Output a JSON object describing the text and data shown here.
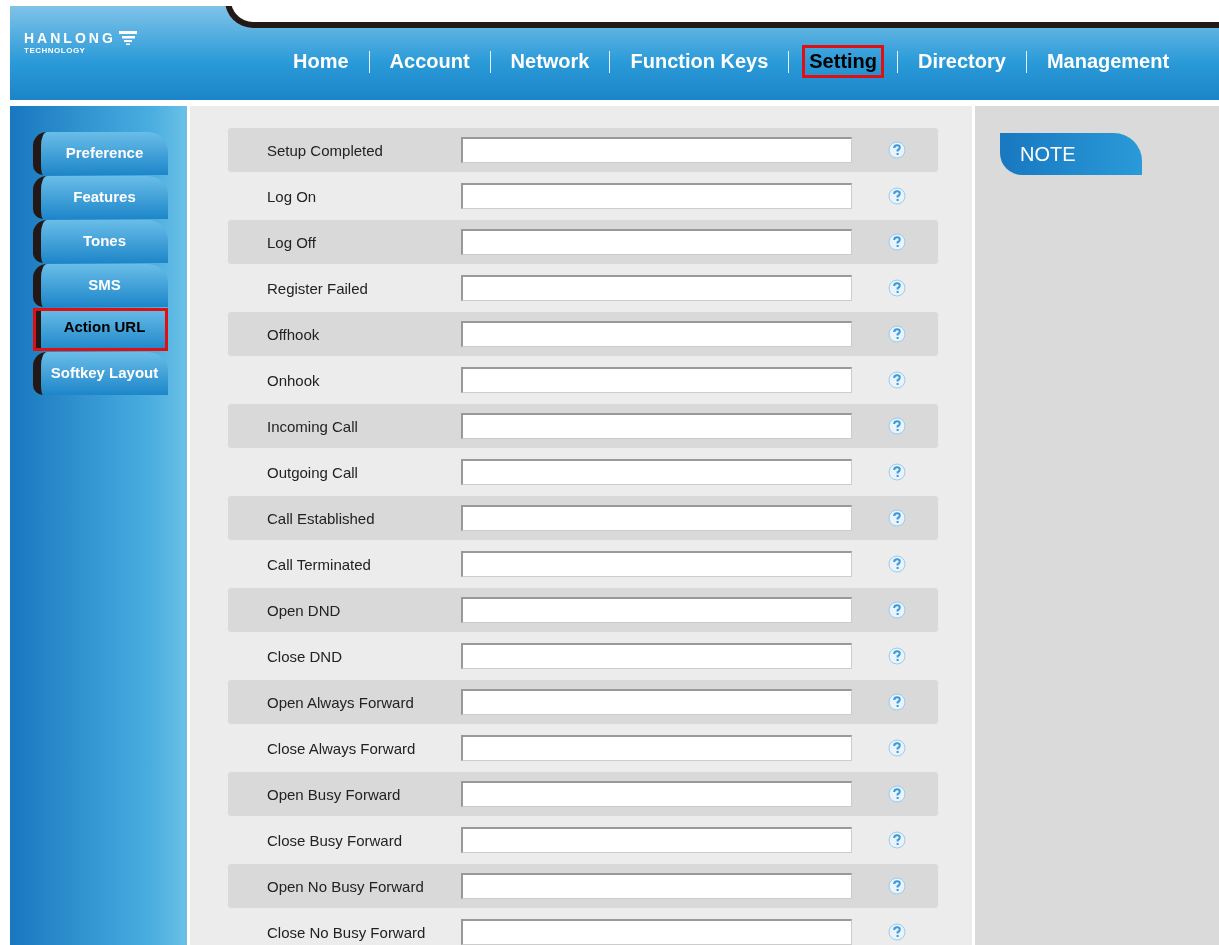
{
  "logo": {
    "name": "HANLONG",
    "tagline": "TECHNOLOGY"
  },
  "nav": [
    {
      "label": "Home",
      "selected": false
    },
    {
      "label": "Account",
      "selected": false
    },
    {
      "label": "Network",
      "selected": false
    },
    {
      "label": "Function Keys",
      "selected": false
    },
    {
      "label": "Setting",
      "selected": true
    },
    {
      "label": "Directory",
      "selected": false
    },
    {
      "label": "Management",
      "selected": false
    }
  ],
  "sidebar": [
    {
      "label": "Preference",
      "selected": false
    },
    {
      "label": "Features",
      "selected": false
    },
    {
      "label": "Tones",
      "selected": false
    },
    {
      "label": "SMS",
      "selected": false
    },
    {
      "label": "Action URL",
      "selected": true
    },
    {
      "label": "Softkey Layout",
      "selected": false
    }
  ],
  "fields": [
    {
      "label": "Setup Completed"
    },
    {
      "label": "Log On"
    },
    {
      "label": "Log Off"
    },
    {
      "label": "Register Failed"
    },
    {
      "label": "Offhook"
    },
    {
      "label": "Onhook"
    },
    {
      "label": "Incoming Call"
    },
    {
      "label": "Outgoing Call"
    },
    {
      "label": "Call Established"
    },
    {
      "label": "Call Terminated"
    },
    {
      "label": "Open DND"
    },
    {
      "label": "Close DND"
    },
    {
      "label": "Open Always Forward"
    },
    {
      "label": "Close Always Forward"
    },
    {
      "label": "Open Busy Forward"
    },
    {
      "label": "Close Busy Forward"
    },
    {
      "label": "Open No Busy Forward"
    },
    {
      "label": "Close No Busy Forward"
    }
  ],
  "note": {
    "title": "NOTE"
  }
}
